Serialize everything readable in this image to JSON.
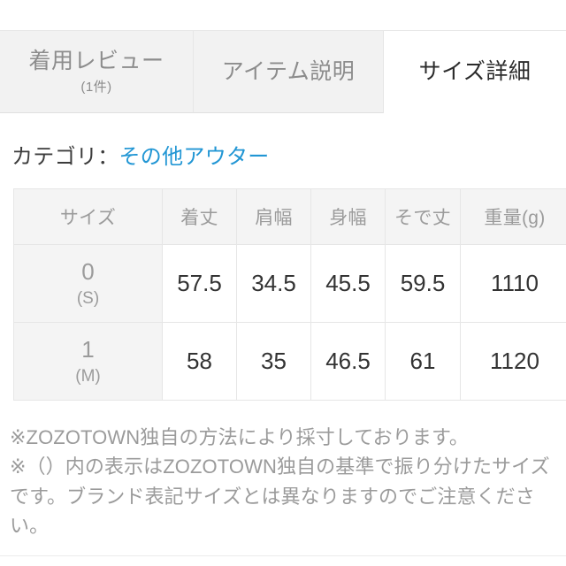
{
  "tabs": [
    {
      "label": "着用レビュー",
      "sub": "(1件)",
      "active": false
    },
    {
      "label": "アイテム説明",
      "sub": "",
      "active": false
    },
    {
      "label": "サイズ詳細",
      "sub": "",
      "active": true
    }
  ],
  "category": {
    "label": "カテゴリ：",
    "link": "その他アウター",
    "link_color": "#2196d4"
  },
  "size_table": {
    "headers": [
      "サイズ",
      "着丈",
      "肩幅",
      "身幅",
      "そで丈",
      "重量(g)"
    ],
    "rows": [
      {
        "size": "0",
        "size_alt": "(S)",
        "values": [
          "57.5",
          "34.5",
          "45.5",
          "59.5",
          "1110"
        ]
      },
      {
        "size": "1",
        "size_alt": "(M)",
        "values": [
          "58",
          "35",
          "46.5",
          "61",
          "1120"
        ]
      }
    ]
  },
  "notes": [
    "※ZOZOTOWN独自の方法により採寸しております。",
    "※（）内の表示はZOZOTOWN独自の基準で振り分けたサイズです。ブランド表記サイズとは異なりますのでご注意ください。"
  ]
}
